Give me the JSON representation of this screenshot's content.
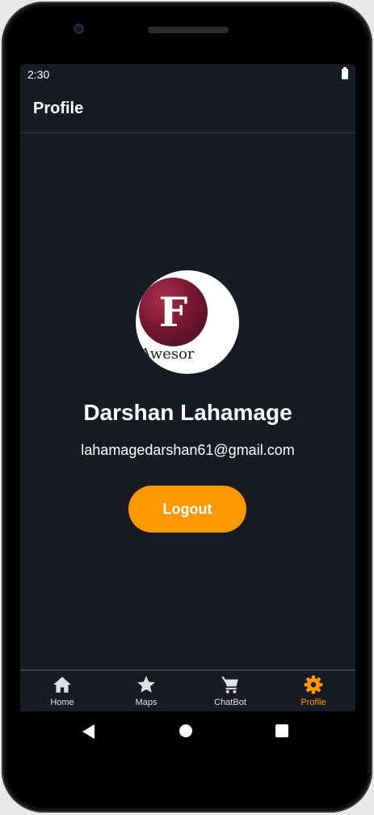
{
  "status": {
    "time": "2:30"
  },
  "appbar": {
    "title": "Profile"
  },
  "profile": {
    "avatar_letter": "F",
    "avatar_text": "nAwesor",
    "name": "Darshan Lahamage",
    "email": "lahamagedarshan61@gmail.com",
    "logout_label": "Logout"
  },
  "nav": {
    "tabs": [
      {
        "label": "Home",
        "icon": "home-icon"
      },
      {
        "label": "Maps",
        "icon": "star-icon"
      },
      {
        "label": "ChatBot",
        "icon": "cart-icon"
      },
      {
        "label": "Profile",
        "icon": "gear-icon",
        "active": true
      }
    ]
  },
  "colors": {
    "accent": "#ff9800",
    "background": "#181a26"
  }
}
